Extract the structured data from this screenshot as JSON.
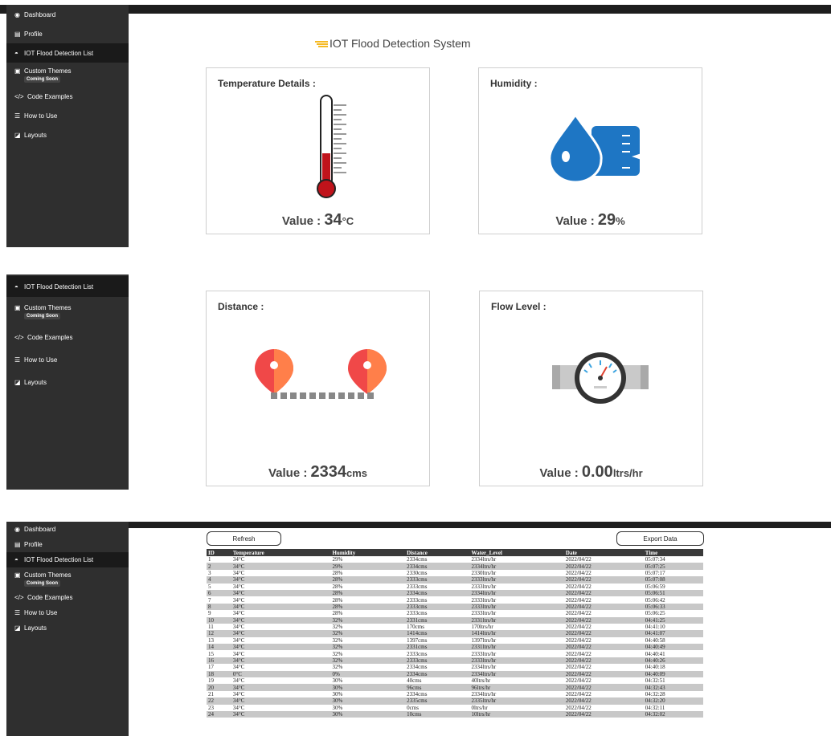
{
  "nav": {
    "dashboard": "Dashboard",
    "profile": "Profile",
    "flood_list": "IOT Flood Detection List",
    "custom_themes": "Custom Themes",
    "coming_soon": "Coming Soon",
    "code_examples": "Code Examples",
    "how_to_use": "How to Use",
    "layouts": "Layouts"
  },
  "header": {
    "title": "IOT Flood Detection System"
  },
  "cards": {
    "temperature": {
      "title": "Temperature Details :",
      "prefix": "Value :",
      "value": "34",
      "unit": "°C"
    },
    "humidity": {
      "title": "Humidity :",
      "prefix": "Value :",
      "value": "29",
      "unit": "%"
    },
    "distance": {
      "title": "Distance :",
      "prefix": "Value :",
      "value": "2334",
      "unit": "cms"
    },
    "flow": {
      "title": "Flow Level :",
      "prefix": "Value :",
      "value": "0.00",
      "unit": "ltrs/hr"
    }
  },
  "toolbar": {
    "refresh": "Refresh",
    "export": "Export Data"
  },
  "table": {
    "columns": [
      "ID",
      "Temperature",
      "Humidity",
      "Distance",
      "Water_Level",
      "Date",
      "Time"
    ],
    "rows": [
      [
        "1",
        "34°C",
        "29%",
        "2334cms",
        "2334ltrs/hr",
        "2022/04/22",
        "05:07:34"
      ],
      [
        "2",
        "34°C",
        "29%",
        "2334cms",
        "2334ltrs/hr",
        "2022/04/22",
        "05:07:25"
      ],
      [
        "3",
        "34°C",
        "28%",
        "2330cms",
        "2330ltrs/hr",
        "2022/04/22",
        "05:07:17"
      ],
      [
        "4",
        "34°C",
        "28%",
        "2333cms",
        "2333ltrs/hr",
        "2022/04/22",
        "05:07:08"
      ],
      [
        "5",
        "34°C",
        "28%",
        "2333cms",
        "2333ltrs/hr",
        "2022/04/22",
        "05:06:59"
      ],
      [
        "6",
        "34°C",
        "28%",
        "2334cms",
        "2334ltrs/hr",
        "2022/04/22",
        "05:06:51"
      ],
      [
        "7",
        "34°C",
        "28%",
        "2333cms",
        "2333ltrs/hr",
        "2022/04/22",
        "05:06:42"
      ],
      [
        "8",
        "34°C",
        "28%",
        "2333cms",
        "2333ltrs/hr",
        "2022/04/22",
        "05:06:33"
      ],
      [
        "9",
        "34°C",
        "28%",
        "2333cms",
        "2333ltrs/hr",
        "2022/04/22",
        "05:06:25"
      ],
      [
        "10",
        "34°C",
        "32%",
        "2331cms",
        "2331ltrs/hr",
        "2022/04/22",
        "04:41:25"
      ],
      [
        "11",
        "34°C",
        "32%",
        "170cms",
        "170ltrs/hr",
        "2022/04/22",
        "04:41:10"
      ],
      [
        "12",
        "34°C",
        "32%",
        "1414cms",
        "1414ltrs/hr",
        "2022/04/22",
        "04:41:07"
      ],
      [
        "13",
        "34°C",
        "32%",
        "1397cms",
        "1397ltrs/hr",
        "2022/04/22",
        "04:40:58"
      ],
      [
        "14",
        "34°C",
        "32%",
        "2331cms",
        "2331ltrs/hr",
        "2022/04/22",
        "04:40:49"
      ],
      [
        "15",
        "34°C",
        "32%",
        "2333cms",
        "2333ltrs/hr",
        "2022/04/22",
        "04:40:41"
      ],
      [
        "16",
        "34°C",
        "32%",
        "2333cms",
        "2333ltrs/hr",
        "2022/04/22",
        "04:40:26"
      ],
      [
        "17",
        "34°C",
        "32%",
        "2334cms",
        "2334ltrs/hr",
        "2022/04/22",
        "04:40:18"
      ],
      [
        "18",
        "0°C",
        "0%",
        "2334cms",
        "2334ltrs/hr",
        "2022/04/22",
        "04:40:09"
      ],
      [
        "19",
        "34°C",
        "30%",
        "40cms",
        "40ltrs/hr",
        "2022/04/22",
        "04:32:51"
      ],
      [
        "20",
        "34°C",
        "30%",
        "96cms",
        "96ltrs/hr",
        "2022/04/22",
        "04:32:43"
      ],
      [
        "21",
        "34°C",
        "30%",
        "2334cms",
        "2334ltrs/hr",
        "2022/04/22",
        "04:32:28"
      ],
      [
        "22",
        "34°C",
        "30%",
        "2335cms",
        "2335ltrs/hr",
        "2022/04/22",
        "04:32:20"
      ],
      [
        "23",
        "34°C",
        "30%",
        "0cms",
        "0ltrs/hr",
        "2022/04/22",
        "04:32:11"
      ],
      [
        "24",
        "34°C",
        "30%",
        "10cms",
        "10ltrs/hr",
        "2022/04/22",
        "04:32:02"
      ]
    ]
  },
  "colors": {
    "sidebar": "#2f2f2f",
    "thermo_red": "#c0131b",
    "humidity_blue": "#1e76c4",
    "pin_red": "#f04848",
    "pin_orange": "#ff7f4a",
    "title_accent": "#f5b922"
  },
  "icons": {
    "title": "lines-icon",
    "temperature": "thermometer-icon",
    "humidity": "water-drop-icon",
    "distance": "map-pins-icon",
    "flow": "flow-meter-icon"
  }
}
